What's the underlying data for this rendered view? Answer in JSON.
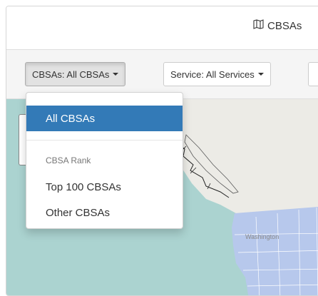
{
  "header": {
    "title": "CBSAs",
    "icon": "map-icon"
  },
  "toolbar": {
    "cbsa_button": "CBSAs: All CBSAs",
    "service_button": "Service: All Services"
  },
  "dropdown": {
    "selected": "All CBSAs",
    "section_header": "CBSA Rank",
    "items": [
      "Top 100 CBSAs",
      "Other CBSAs"
    ]
  },
  "map": {
    "label": "Washington"
  },
  "colors": {
    "accent": "#337ab7",
    "water": "#abd3d0",
    "land": "#ecebe6",
    "county": "#b7c8ec"
  }
}
